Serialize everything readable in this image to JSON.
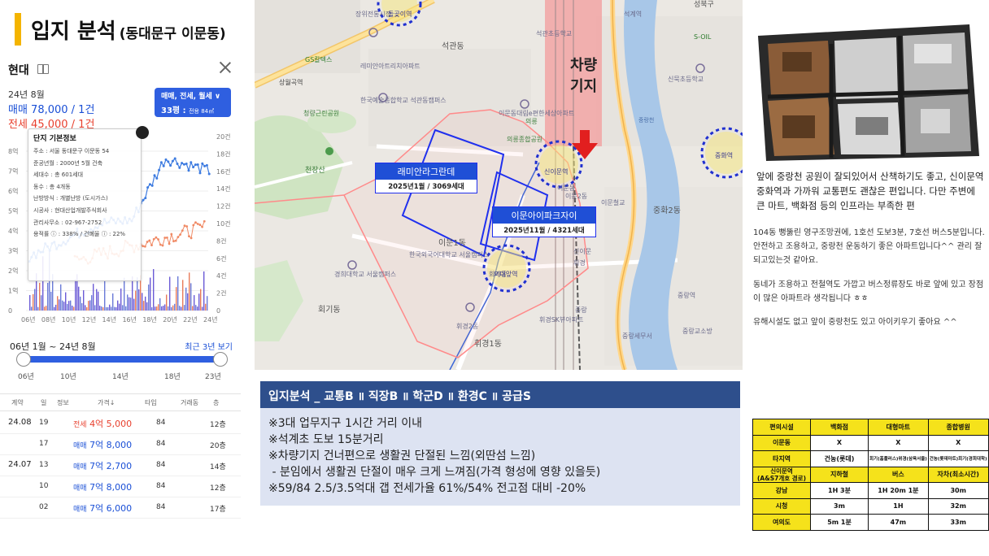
{
  "title": {
    "main": "입지 분석",
    "sub": "(동대문구 이문동)"
  },
  "left_panel": {
    "name": "현대",
    "date": "24년 8월",
    "sale": "매매 78,000 / 1건",
    "rent": "전세 45,000 / 1건",
    "deal_type": "매매, 전세, 월세",
    "deal_area": "33평",
    "deal_area_note": "전용 84㎡",
    "info": {
      "title": "단지 기본정보",
      "lines": [
        "주소 : 서울 동대문구 이문동 54",
        "준공년월 : 2000년 5월 건축",
        "세대수 : 총 601세대",
        "동수 : 총 4개동",
        "난방방식 : 개별난방 (도시가스)",
        "시공사 : 현대산업개발주식회사",
        "관리사무소 : 02-967-2752",
        "용적률 ⓘ : 338% / 건폐율 ⓘ : 22%"
      ]
    },
    "chart": {
      "left_ticks": [
        "8억",
        "7억",
        "6억",
        "5억",
        "4억",
        "3억",
        "2억",
        "1억",
        "0"
      ],
      "right_ticks": [
        "20건",
        "18건",
        "16건",
        "14건",
        "12건",
        "10건",
        "8건",
        "6건",
        "4건",
        "2건",
        "0"
      ],
      "x_ticks": [
        "06년",
        "08년",
        "10년",
        "12년",
        "14년",
        "16년",
        "18년",
        "20년",
        "22년",
        "24년"
      ]
    },
    "period": "06년 1월 ~ 24년 8월",
    "recent_link": "최근 3년 보기",
    "slider_ticks": [
      "06년",
      "10년",
      "14년",
      "18년",
      "23년"
    ],
    "table_headers": [
      "계약",
      "일",
      "정보",
      "가격↓",
      "타입",
      "거래동",
      "층"
    ],
    "transactions": [
      {
        "month": "24.08",
        "day": "19",
        "kind": "전세",
        "price": "4억 5,000",
        "type": "84",
        "floor": "12층"
      },
      {
        "month": "",
        "day": "17",
        "kind": "매매",
        "price": "7억 8,000",
        "type": "84",
        "floor": "20층"
      },
      {
        "month": "24.07",
        "day": "13",
        "kind": "매매",
        "price": "7억 2,700",
        "type": "84",
        "floor": "14층"
      },
      {
        "month": "",
        "day": "10",
        "kind": "매매",
        "price": "7억 8,000",
        "type": "84",
        "floor": "12층"
      },
      {
        "month": "",
        "day": "02",
        "kind": "매매",
        "price": "7억 6,000",
        "type": "84",
        "floor": "17층"
      }
    ]
  },
  "map": {
    "depot_label_1": "차량",
    "depot_label_2": "기지",
    "project1_name": "래미안라그란데",
    "project1_info": "2025년1월 / 3069세대",
    "project2_name": "이문아이파크자이",
    "project2_info": "2025년11월 / 4321세대",
    "stations": [
      "돌곶이역",
      "신이문역",
      "외대앞역",
      "중화역"
    ],
    "places": [
      {
        "label": "장위전통시장"
      },
      {
        "label": "석관동"
      },
      {
        "label": "레미안아트리치아파트"
      },
      {
        "label": "한국예술종합학교 석관동캠퍼스"
      },
      {
        "label": "청량근린공원"
      },
      {
        "label": "이문동대림e편한세상아파트"
      },
      {
        "label": "의릉"
      },
      {
        "label": "의릉종합공원"
      },
      {
        "label": "천장산"
      },
      {
        "label": "이문1동"
      },
      {
        "label": "한국외국어대학교 서울캠퍼스"
      },
      {
        "label": "경희대학교 서울캠퍼스"
      },
      {
        "label": "회기동"
      },
      {
        "label": "휘경1동"
      },
      {
        "label": "휘경SK뷰아파트"
      },
      {
        "label": "중랑천"
      },
      {
        "label": "중화2동"
      },
      {
        "label": "중랑역"
      },
      {
        "label": "중랑세무서"
      },
      {
        "label": "중랑교소방"
      },
      {
        "label": "신묵초등학교"
      },
      {
        "label": "석계역"
      },
      {
        "label": "S-OIL"
      },
      {
        "label": "성북구"
      },
      {
        "label": "상월곡역"
      },
      {
        "label": "GS칼텍스"
      },
      {
        "label": "이문2동"
      },
      {
        "label": "이문동"
      },
      {
        "label": "이문철교"
      },
      {
        "label": "회기동"
      },
      {
        "label": "휘경2동"
      },
      {
        "label": "석관초등학교"
      },
      {
        "label": "신이문"
      },
      {
        "label": "휘경"
      },
      {
        "label": "중랑"
      }
    ]
  },
  "review": {
    "main": "앞에 중랑천 공원이 잘되있어서 산책하기도 좋고, 신이문역 중화역과 가까워 교통편도 괜찮은 편입니다. 다만 주변에 큰 마트, 백화점 등의 인프라는 부족한 편",
    "p1": "104동 뻥뚫린 영구조망권에, 1호선 도보3분, 7호선 버스5분입니다. 안전하고 조용하고, 중랑천 운동하기 좋은 아파트입니다^^ 관리 잘되고있는것 같아요.",
    "p2": "동네가 조용하고 전철역도 가깝고 버스정류장도 바로 앞에 있고 장점이 많은 아파트라 생각됩니다 ㅎㅎ",
    "p3": "유해시설도 없고 앞이 중랑천도 있고 아이키우기 좋아요 ^^"
  },
  "analysis": {
    "header": "입지분석 _ 교통B ॥ 직장B ॥ 학군D ॥ 환경C ॥ 공급S",
    "lines": [
      "※3대 업무지구 1시간 거리 이내",
      "※석계초 도보 15분거리",
      "※차량기지 건너편으로 생활권 단절된 느낌(외딴섬 느낌)",
      " - 분임에서 생활권 단절이 매우 크게 느껴짐(가격 형성에 영향 있을듯)",
      "※59/84 2.5/3.5억대 갭 전세가율 61%/54% 전고점 대비 -20%"
    ]
  },
  "table": {
    "rows": [
      [
        "편의시설",
        "백화점",
        "대형마트",
        "종합병원"
      ],
      [
        "이문동",
        "X",
        "X",
        "X"
      ],
      [
        "타지역",
        "건농(롯데)",
        "회기(홈플러스)위경(삼육서울)",
        "건농(롯데마트)회기(경희대학)"
      ],
      [
        "신이문역\n(A&S7개호 경로)",
        "지하철",
        "버스",
        "자차(최소시간)"
      ],
      [
        "강남",
        "1H 3분",
        "1H 20m 1분",
        "30m"
      ],
      [
        "시청",
        "3m",
        "1H",
        "32m"
      ],
      [
        "여의도",
        "5m 1분",
        "47m",
        "33m"
      ]
    ]
  },
  "colors": {
    "accent": "#f4b400",
    "sale": "#1a4fd6",
    "rent": "#e8402e",
    "analysis_header": "#2e4f8c",
    "analysis_body": "#dde3f2",
    "table_yellow": "#f5e21b"
  },
  "icons": [
    "book-icon",
    "close-icon",
    "arrow-down-icon",
    "school-icon",
    "park-icon"
  ]
}
